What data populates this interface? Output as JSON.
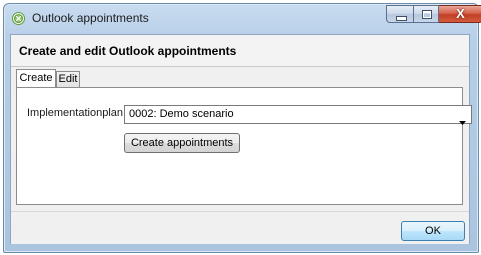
{
  "window": {
    "title": "Outlook appointments",
    "icon": "green-circle-x-icon",
    "buttons": [
      "minimize-icon",
      "maximize-icon",
      "close-icon"
    ],
    "close_glyph": "X"
  },
  "header": {
    "title": "Create and edit Outlook appointments"
  },
  "tabs": [
    {
      "label": "Create",
      "selected": true
    },
    {
      "label": "Edit",
      "selected": false
    }
  ],
  "form": {
    "implementation_label": "Implementationplan",
    "implementation_value": "0002: Demo scenario",
    "create_button": "Create appointments"
  },
  "footer": {
    "ok_button": "OK"
  },
  "colors": {
    "titlebar": "#b7cfe8",
    "close_button": "#c13f26",
    "ok_border": "#3c7fb1",
    "app_icon": "#5d9a3c"
  }
}
